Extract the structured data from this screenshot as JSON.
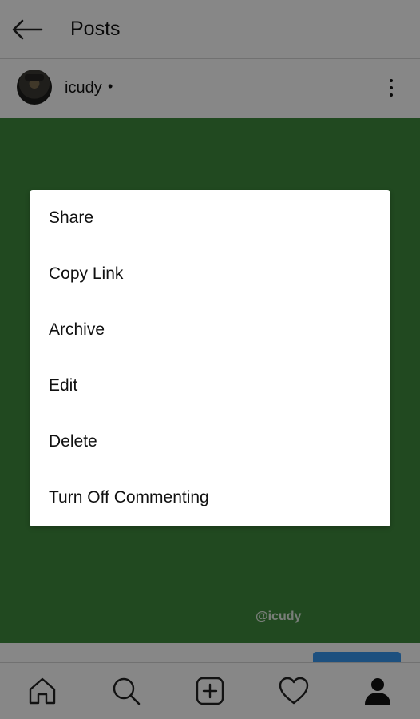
{
  "header": {
    "title": "Posts",
    "back_icon": "arrow-left-icon"
  },
  "post": {
    "username": "icudy",
    "separator": "•",
    "watermark": "@icudy",
    "more_icon": "more-vertical-icon"
  },
  "menu": {
    "items": [
      {
        "label": "Share"
      },
      {
        "label": "Copy Link"
      },
      {
        "label": "Archive"
      },
      {
        "label": "Edit"
      },
      {
        "label": "Delete"
      },
      {
        "label": "Turn Off Commenting"
      }
    ]
  },
  "bottom_nav": {
    "items": [
      {
        "icon": "home-icon"
      },
      {
        "icon": "search-icon"
      },
      {
        "icon": "add-post-icon"
      },
      {
        "icon": "heart-icon"
      },
      {
        "icon": "profile-icon"
      }
    ]
  },
  "colors": {
    "post_background": "#3f8a3d",
    "overlay": "rgba(0,0,0,0.47)",
    "cta_blue": "#3897f0"
  }
}
